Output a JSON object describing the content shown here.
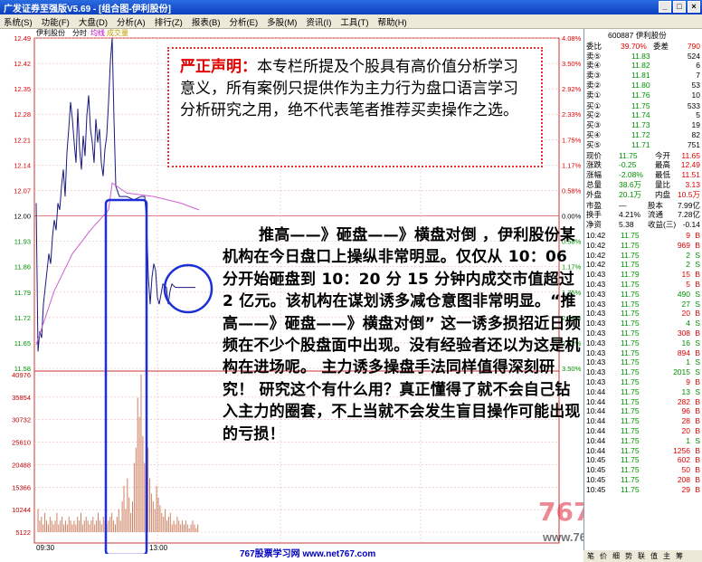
{
  "window": {
    "title": "广发证券至强版V5.69 - [组合图-伊利股份]",
    "controls": [
      "_",
      "□",
      "×"
    ]
  },
  "menu": [
    "系统(S)",
    "功能(F)",
    "大盘(D)",
    "分析(A)",
    "排行(Z)",
    "报表(B)",
    "分析(E)",
    "多股(M)",
    "资讯(I)",
    "工具(T)",
    "帮助(H)"
  ],
  "chart": {
    "header": {
      "name": "伊利股份",
      "tab1": "分时",
      "tab2": "均线",
      "tab3": "成交量"
    },
    "price_ticks": [
      "12.49",
      "12.42",
      "12.35",
      "12.28",
      "12.21",
      "12.14",
      "12.07",
      "12.00",
      "11.93",
      "11.86",
      "11.79",
      "11.72",
      "11.65",
      "11.58"
    ],
    "pct_ticks": [
      "4.08%",
      "3.50%",
      "2.92%",
      "2.33%",
      "1.75%",
      "1.17%",
      "0.58%",
      "0.00%",
      "0.58%",
      "1.17%",
      "1.75%",
      "2.33%",
      "2.92%",
      "3.50%"
    ],
    "vol_ticks": [
      "40976",
      "35854",
      "30732",
      "25610",
      "20488",
      "15366",
      "10244",
      "5122"
    ],
    "time_start": "09:30",
    "time_mid": "13:00"
  },
  "chart_data": {
    "type": "line",
    "title": "",
    "x": [
      "09:30",
      "10:00",
      "10:06",
      "10:20",
      "10:30"
    ],
    "series": [
      {
        "values": [
          11.55,
          12.27,
          12.42,
          12.0,
          11.73
        ]
      },
      {
        "values": [
          11.55,
          11.9,
          12.05,
          12.02,
          11.98
        ]
      }
    ],
    "ylim": [
      11.51,
      12.49
    ],
    "grid": true,
    "volume_ylim": [
      0,
      40976
    ]
  },
  "notice": {
    "heading": "严正声明：",
    "body": "本专栏所提及个股具有高价值分析学习意义，所有案例只提供作为主力行为盘口语言学习分析研究之用，绝不代表笔者推荐买卖操作之选。"
  },
  "article": {
    "text": "推高——》砸盘——》横盘对倒 ，伊利股份某机构在今日盘口上操纵非常明显。仅仅从 10：06 分开始砸盘到 10：20 分 15 分钟内成交市值超过 2 亿元。该机构在谋划诱多减仓意图非常明显。“推高——》砸盘——》横盘对倒” 这一诱多损招近日频频在不少个股盘面中出现。没有经验者还以为这是机构在进场呢。 主力诱多操盘手法同样值得深刻研究！ 研究这个有什么用？真正懂得了就不会自己钻入主力的圈套，不上当就不会发生盲目操作可能出现的亏损！"
  },
  "footer": {
    "site": "767股票学习网 www.net767.com"
  },
  "watermark": {
    "brand": "767股票网",
    "url": "www.767gup1.com"
  },
  "panel": {
    "code": "600887 伊利股份",
    "weibi": {
      "label": "委比",
      "value": "39.70%",
      "label2": "委差",
      "value2": "790"
    },
    "sells": [
      {
        "label": "卖⑤",
        "price": "11.83",
        "vol": "524"
      },
      {
        "label": "卖④",
        "price": "11.82",
        "vol": "6"
      },
      {
        "label": "卖③",
        "price": "11.81",
        "vol": "7"
      },
      {
        "label": "卖②",
        "price": "11.80",
        "vol": "53"
      },
      {
        "label": "卖①",
        "price": "11.76",
        "vol": "10"
      }
    ],
    "buys": [
      {
        "label": "买①",
        "price": "11.75",
        "vol": "533"
      },
      {
        "label": "买②",
        "price": "11.74",
        "vol": "5"
      },
      {
        "label": "买③",
        "price": "11.73",
        "vol": "19"
      },
      {
        "label": "买④",
        "price": "11.72",
        "vol": "82"
      },
      {
        "label": "买⑤",
        "price": "11.71",
        "vol": "751"
      }
    ],
    "stats": [
      {
        "l1": "现价",
        "v1": "11.75",
        "l2": "今开",
        "v2": "11.65"
      },
      {
        "l1": "涨跌",
        "v1": "-0.25",
        "l2": "最高",
        "v2": "12.49"
      },
      {
        "l1": "涨幅",
        "v1": "-2.08%",
        "l2": "最低",
        "v2": "11.51"
      },
      {
        "l1": "总量",
        "v1": "38.6万",
        "l2": "量比",
        "v2": "3.13"
      },
      {
        "l1": "外盘",
        "v1": "20.1万",
        "l2": "内盘",
        "v2": "10.5万"
      }
    ],
    "stats2": [
      {
        "l1": "市盈",
        "v1": "—",
        "l2": "股本",
        "v2": "7.99亿"
      },
      {
        "l1": "换手",
        "v1": "4.21%",
        "l2": "流通",
        "v2": "7.28亿"
      },
      {
        "l1": "净资",
        "v1": "5.38",
        "l2": "收益(三)",
        "v2": "-0.14"
      }
    ],
    "ticks": [
      {
        "t": "10:42",
        "p": "11.75",
        "v": "9",
        "s": "B"
      },
      {
        "t": "10:42",
        "p": "11.75",
        "v": "969",
        "s": "B"
      },
      {
        "t": "10:42",
        "p": "11.75",
        "v": "2",
        "s": "S"
      },
      {
        "t": "10:42",
        "p": "11.75",
        "v": "2",
        "s": "S"
      },
      {
        "t": "10:43",
        "p": "11.79",
        "v": "15",
        "s": "B"
      },
      {
        "t": "10:43",
        "p": "11.75",
        "v": "5",
        "s": "B"
      },
      {
        "t": "10:43",
        "p": "11.75",
        "v": "490",
        "s": "S"
      },
      {
        "t": "10:43",
        "p": "11.75",
        "v": "27",
        "s": "S"
      },
      {
        "t": "10:43",
        "p": "11.75",
        "v": "20",
        "s": "B"
      },
      {
        "t": "10:43",
        "p": "11.75",
        "v": "4",
        "s": "S"
      },
      {
        "t": "10:43",
        "p": "11.75",
        "v": "308",
        "s": "B"
      },
      {
        "t": "10:43",
        "p": "11.75",
        "v": "16",
        "s": "S"
      },
      {
        "t": "10:43",
        "p": "11.75",
        "v": "894",
        "s": "B"
      },
      {
        "t": "10:43",
        "p": "11.75",
        "v": "1",
        "s": "S"
      },
      {
        "t": "10:43",
        "p": "11.75",
        "v": "2015",
        "s": "S"
      },
      {
        "t": "10:43",
        "p": "11.75",
        "v": "9",
        "s": "B"
      },
      {
        "t": "10:44",
        "p": "11.75",
        "v": "13",
        "s": "S"
      },
      {
        "t": "10:44",
        "p": "11.75",
        "v": "282",
        "s": "B"
      },
      {
        "t": "10:44",
        "p": "11.75",
        "v": "96",
        "s": "B"
      },
      {
        "t": "10:44",
        "p": "11.75",
        "v": "28",
        "s": "B"
      },
      {
        "t": "10:44",
        "p": "11.75",
        "v": "20",
        "s": "B"
      },
      {
        "t": "10:44",
        "p": "11.75",
        "v": "1",
        "s": "S"
      },
      {
        "t": "10:44",
        "p": "11.75",
        "v": "1256",
        "s": "B"
      },
      {
        "t": "10:45",
        "p": "11.75",
        "v": "602",
        "s": "B"
      },
      {
        "t": "10:45",
        "p": "11.75",
        "v": "50",
        "s": "B"
      },
      {
        "t": "10:45",
        "p": "11.75",
        "v": "208",
        "s": "B"
      },
      {
        "t": "10:45",
        "p": "11.75",
        "v": "29",
        "s": "B"
      }
    ],
    "tabs": [
      "笔",
      "价",
      "细",
      "势",
      "联",
      "值",
      "主",
      "筹"
    ]
  }
}
